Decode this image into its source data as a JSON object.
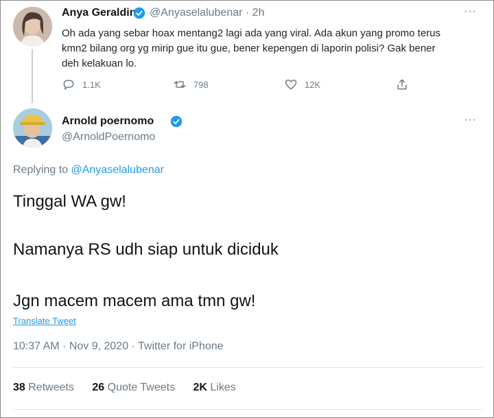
{
  "colors": {
    "link": "#1d9bf0",
    "muted": "#6b7a86",
    "verified": "#1d9bf0"
  },
  "parent_tweet": {
    "display_name": "Anya Geraldine",
    "handle": "@Anyaselalubenar",
    "time": "· 2h",
    "more": "···",
    "text": "Oh ada yang sebar hoax mentang2 lagi ada yang viral. Ada akun yang promo terus kmn2 bilang org yg mirip gue itu gue, bener kepengen di laporin polisi? Gak bener deh kelakuan lo.",
    "actions": {
      "replies": "1.1K",
      "retweets": "798",
      "likes": "12K"
    }
  },
  "reply_tweet": {
    "display_name": "Arnold poernomo",
    "handle": "@ArnoldPoernomo",
    "more": "···",
    "replying_prefix": "Replying to ",
    "replying_handle": "@Anyaselalubenar",
    "lines": [
      "Tinggal WA gw!",
      "Namanya RS udh siap untuk diciduk",
      "Jgn macem macem ama tmn gw!"
    ],
    "translate": "Translate Tweet",
    "meta": "10:37 AM · Nov 9, 2020 · Twitter for iPhone",
    "stats": {
      "retweets_count": "38",
      "retweets_label": " Retweets",
      "quotes_count": "26",
      "quotes_label": " Quote Tweets",
      "likes_count": "2K",
      "likes_label": " Likes"
    }
  }
}
